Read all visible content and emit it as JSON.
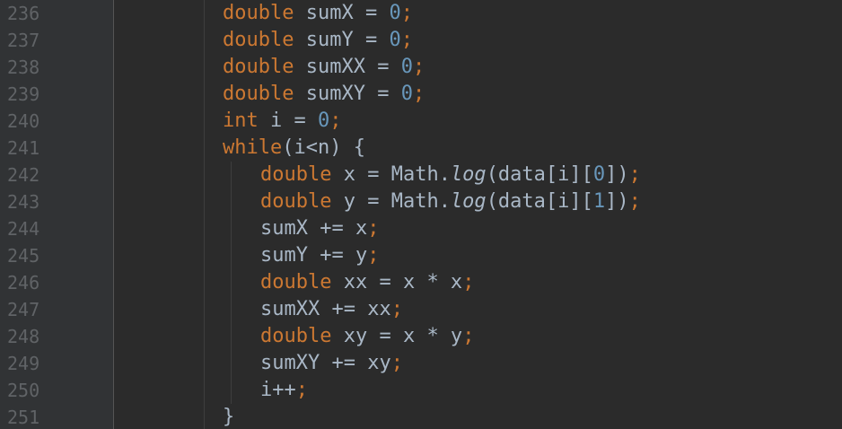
{
  "editor": {
    "language": "Java",
    "colors": {
      "background": "#2b2b2b",
      "gutter": "#313335",
      "line_number": "#606366",
      "keyword": "#cc7832",
      "number": "#6897bb",
      "text": "#a9b7c6"
    },
    "line_numbers": [
      "236",
      "237",
      "238",
      "239",
      "240",
      "241",
      "242",
      "243",
      "244",
      "245",
      "246",
      "247",
      "248",
      "249",
      "250",
      "251"
    ],
    "lines": [
      [
        "double",
        " sumX = ",
        "0",
        ";"
      ],
      [
        "double",
        " sumY = ",
        "0",
        ";"
      ],
      [
        "double",
        " sumXX = ",
        "0",
        ";"
      ],
      [
        "double",
        " sumXY = ",
        "0",
        ";"
      ],
      [
        "int",
        " i = ",
        "0",
        ";"
      ],
      [
        "while",
        "(i<n) {"
      ],
      [
        "double",
        " x = Math.",
        "log",
        "(data[i][",
        "0",
        "])",
        ";"
      ],
      [
        "double",
        " y = Math.",
        "log",
        "(data[i][",
        "1",
        "])",
        ";"
      ],
      [
        "sumX += x",
        ";"
      ],
      [
        "sumY += y",
        ";"
      ],
      [
        "double",
        " xx = x * x",
        ";"
      ],
      [
        "sumXX += xx",
        ";"
      ],
      [
        "double",
        " xy = x * y",
        ";"
      ],
      [
        "sumXY += xy",
        ";"
      ],
      [
        "i++",
        ";"
      ],
      [
        "}"
      ]
    ]
  }
}
